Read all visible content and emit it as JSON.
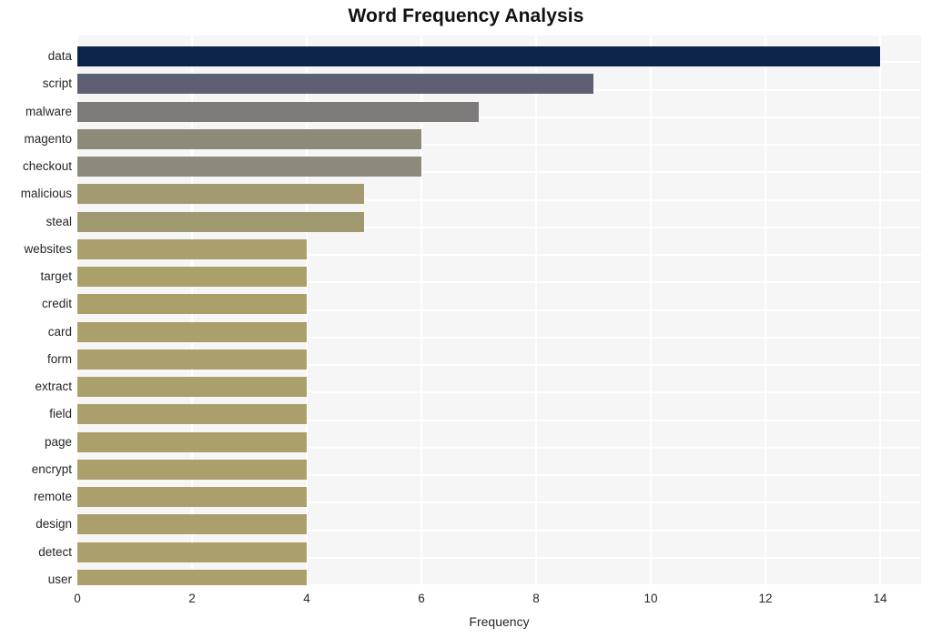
{
  "chart_data": {
    "type": "bar",
    "orientation": "horizontal",
    "title": "Word Frequency Analysis",
    "xlabel": "Frequency",
    "ylabel": "",
    "categories": [
      "data",
      "script",
      "malware",
      "magento",
      "checkout",
      "malicious",
      "steal",
      "websites",
      "target",
      "credit",
      "card",
      "form",
      "extract",
      "field",
      "page",
      "encrypt",
      "remote",
      "design",
      "detect",
      "user"
    ],
    "values": [
      14,
      9,
      7,
      6,
      6,
      5,
      5,
      4,
      4,
      4,
      4,
      4,
      4,
      4,
      4,
      4,
      4,
      4,
      4,
      4
    ],
    "bar_colors": [
      "#0b2448",
      "#5c6072",
      "#7c7b79",
      "#8e8a79",
      "#8c8a7b",
      "#a39a71",
      "#a0996f",
      "#ab9f6b",
      "#ab9f6b",
      "#ab9f6b",
      "#ab9f6b",
      "#ab9f6b",
      "#ab9f6b",
      "#ab9f6b",
      "#ab9f6b",
      "#ab9f6b",
      "#ab9f6b",
      "#ab9f6b",
      "#ab9f6b",
      "#ab9f6b"
    ],
    "xticks": [
      0,
      2,
      4,
      6,
      8,
      10,
      12,
      14
    ],
    "xlim": [
      0,
      14.7
    ],
    "grid": true,
    "legend": false,
    "plot_background": "#f6f6f7",
    "grid_color": "#ffffff"
  }
}
